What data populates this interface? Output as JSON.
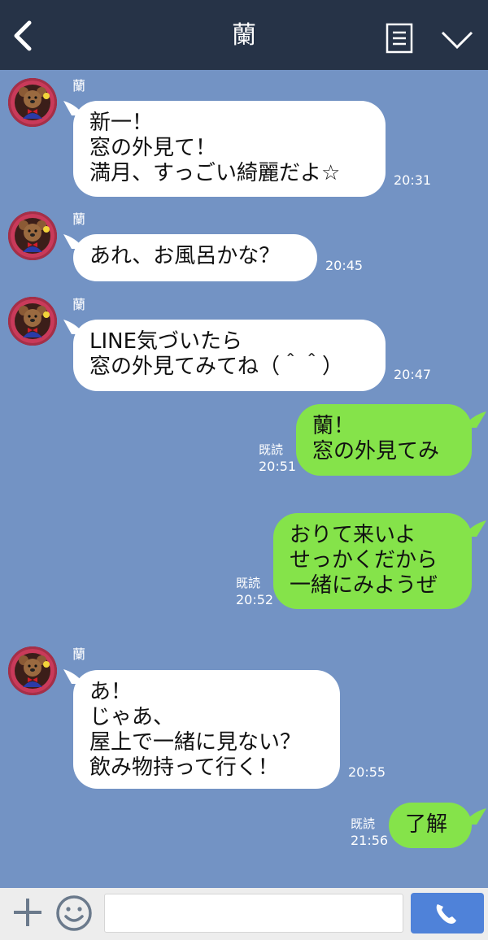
{
  "header": {
    "title": "蘭",
    "bg": "#263347"
  },
  "colors": {
    "chat_bg": "#7393c4",
    "incoming": "#ffffff",
    "outgoing": "#85e34a",
    "send_button": "#4f82d9"
  },
  "messages": [
    {
      "sender": "蘭",
      "text": "新一！\n窓の外見て！\n満月、すっごい綺麗だよ☆",
      "time": "20:31"
    },
    {
      "sender": "蘭",
      "text": "あれ、お風呂かな？",
      "time": "20:45"
    },
    {
      "sender": "蘭",
      "text": "LINE気づいたら\n窓の外見てみてね（＾＾）",
      "time": "20:47"
    },
    {
      "text": "蘭！\n窓の外見てみ",
      "read": "既読",
      "time": "20:51"
    },
    {
      "text": "おりて来いよ\nせっかくだから\n一緒にみようぜ",
      "read": "既読",
      "time": "20:52"
    },
    {
      "sender": "蘭",
      "text": "あ！\nじゃあ、\n屋上で一緒に見ない？\n飲み物持って行く！",
      "time": "20:55"
    },
    {
      "text": "了解",
      "read": "既読",
      "time": "21:56"
    }
  ],
  "input": {
    "placeholder": ""
  },
  "icons": {
    "back": "chevron-left-icon",
    "menu": "notes-icon",
    "dropdown": "chevron-down-icon",
    "attach": "plus-icon",
    "sticker": "smiley-icon",
    "call": "phone-icon"
  }
}
